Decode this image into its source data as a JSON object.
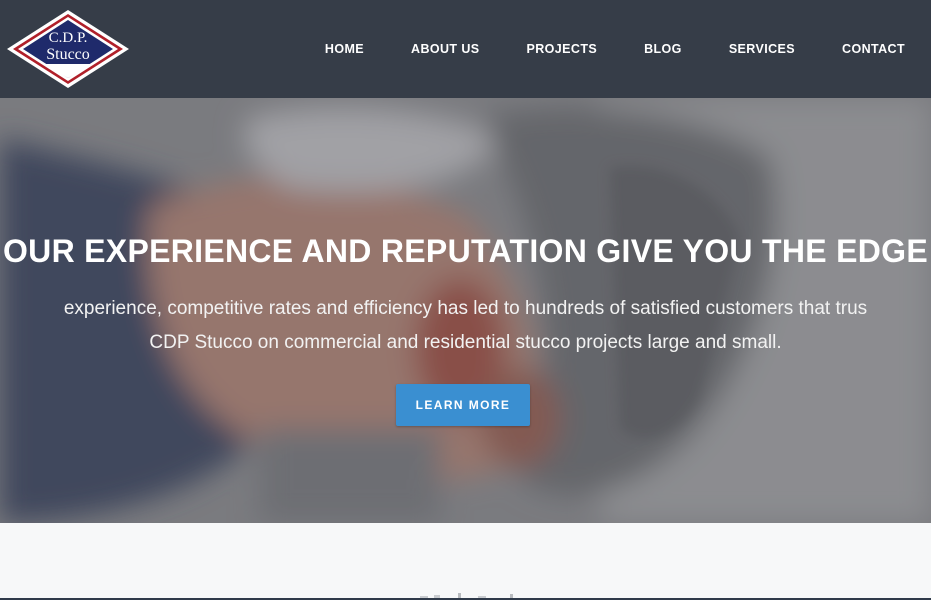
{
  "logo": {
    "line1": "C.D.P.",
    "line2": "Stucco"
  },
  "nav": {
    "items": [
      {
        "label": "HOME"
      },
      {
        "label": "ABOUT US"
      },
      {
        "label": "PROJECTS"
      },
      {
        "label": "BLOG"
      },
      {
        "label": "SERVICES"
      },
      {
        "label": "CONTACT"
      }
    ]
  },
  "hero": {
    "title": "OUR EXPERIENCE AND REPUTATION GIVE YOU THE EDGE",
    "text_line1": "experience, competitive rates and efficiency has led to hundreds of satisfied customers that trus",
    "text_line2": "CDP Stucco on commercial and residential stucco projects large and small.",
    "button_label": "LEARN MORE"
  },
  "colors": {
    "header_bg": "#363d48",
    "accent": "#3a8fd1",
    "logo_navy": "#1f2a6b",
    "logo_red": "#b0202a"
  }
}
